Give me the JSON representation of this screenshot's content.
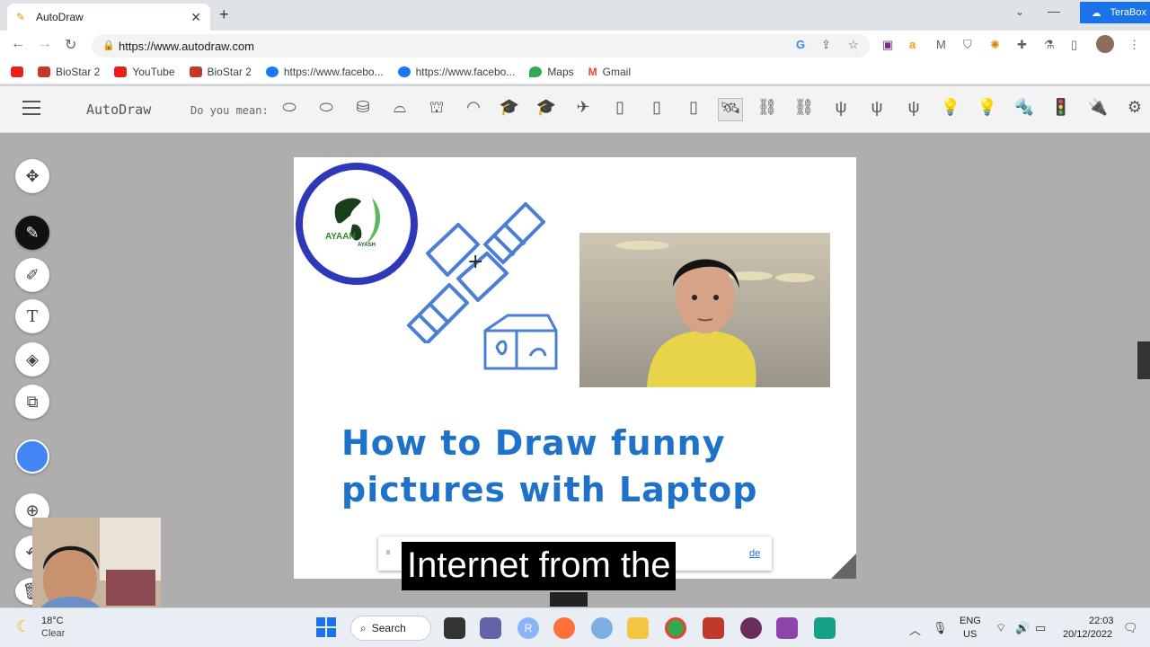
{
  "browser": {
    "tab_title": "AutoDraw",
    "url": "https://www.autodraw.com",
    "terabox_label": "TeraBox",
    "bookmarks": [
      {
        "label": "",
        "color": "#e62117"
      },
      {
        "label": "BioStar 2",
        "color": "#c0392b"
      },
      {
        "label": "YouTube",
        "color": "#e62117"
      },
      {
        "label": "BioStar 2",
        "color": "#c0392b"
      },
      {
        "label": "https://www.facebo...",
        "color": "#1877f2"
      },
      {
        "label": "https://www.facebo...",
        "color": "#1877f2"
      },
      {
        "label": "Maps",
        "color": "#34a853"
      },
      {
        "label": "Gmail",
        "color": "#ea4335"
      }
    ]
  },
  "autodraw": {
    "title": "AutoDraw",
    "do_you_mean": "Do you mean:",
    "suggestions": [
      "⬭",
      "⬭",
      "⛁",
      "⌓",
      "⛫",
      "◠",
      "🎓",
      "🎓",
      "✈",
      "▯",
      "▯",
      "▯",
      "🛰",
      "⛓",
      "⛓",
      "ψ",
      "ψ",
      "ψ",
      "💡",
      "💡",
      "🔩",
      "🚦",
      "🔌",
      "⚙"
    ],
    "selected_suggestion_index": 12,
    "tools": [
      "move-icon",
      "autodraw-icon",
      "pencil-icon",
      "text-icon",
      "fill-icon",
      "shape-icon"
    ],
    "color_accent": "#4285f4"
  },
  "canvas": {
    "logo_text": "AYAAN",
    "logo_subtext": "AYASH",
    "headline_line1": "How to Draw funny",
    "headline_line2": "pictures with Laptop",
    "headline_color": "#1f72c9"
  },
  "overlay": {
    "caption": "Internet from the",
    "link_fragment": "de"
  },
  "taskbar": {
    "temperature": "18°C",
    "weather": "Clear",
    "search_label": "Search",
    "lang_line1": "ENG",
    "lang_line2": "US",
    "time": "22:03",
    "date": "20/12/2022"
  }
}
